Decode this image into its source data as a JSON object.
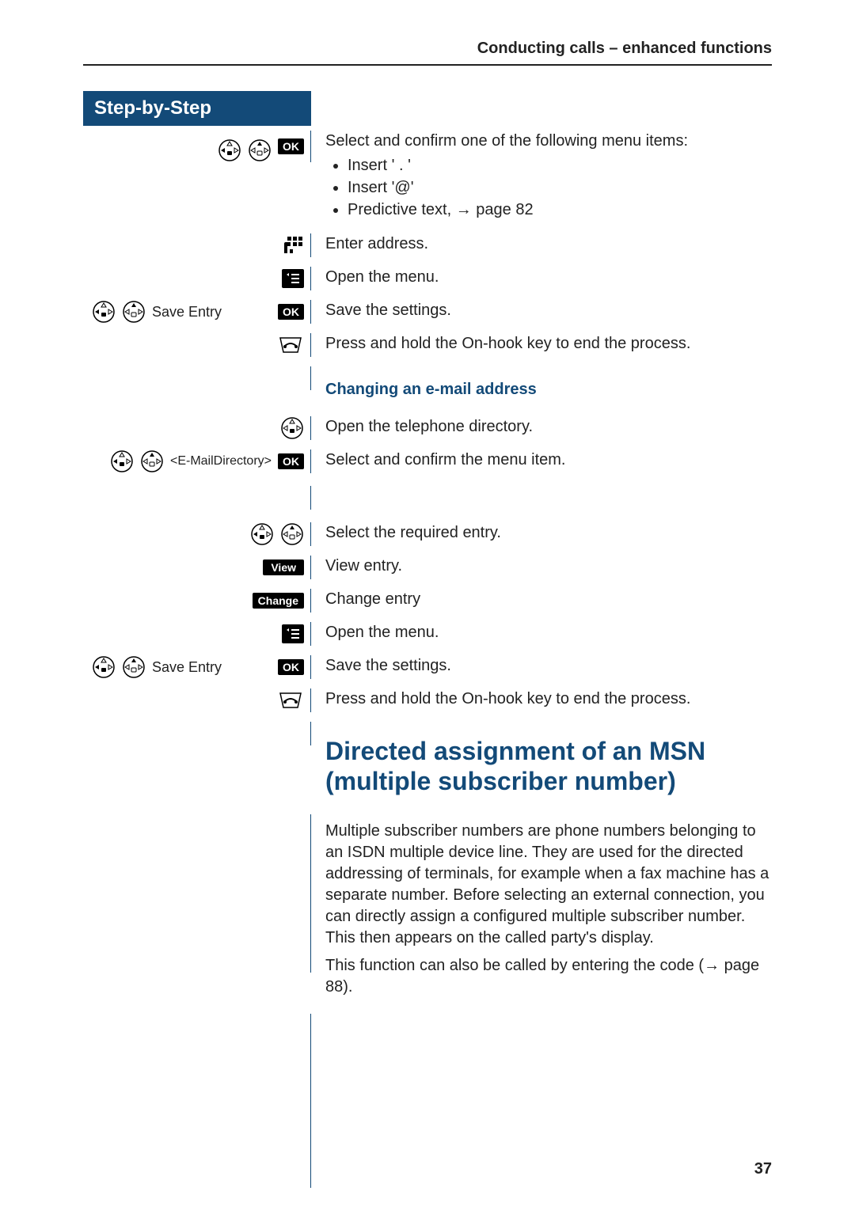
{
  "header": "Conducting calls – enhanced functions",
  "left_header": "Step-by-Step",
  "page_number": "37",
  "block1": {
    "intro": "Select and confirm one of the following menu items:",
    "items": [
      "Insert ' . '",
      "Insert '@'",
      "Predictive text, → page 82"
    ],
    "r2": "Enter address.",
    "r3": "Open the menu.",
    "r4_label": "Save Entry",
    "r4": "Save the settings.",
    "r5": "Press and hold the On-hook key to end the process."
  },
  "subheading": "Changing an e-mail address",
  "block2": {
    "r1": "Open the telephone directory.",
    "r2_label": "<E-MailDirectory>",
    "r2": "Select and confirm the menu item.",
    "r3": "Select the required entry.",
    "r4_btn": "View",
    "r4": "View entry.",
    "r5_btn": "Change",
    "r5": "Change entry",
    "r6": "Open the menu.",
    "r7_label": "Save Entry",
    "r7": "Save the settings.",
    "r8": "Press and hold the On-hook key to end the process."
  },
  "section_title": "Directed assignment of an MSN (multiple subscriber number)",
  "para1": "Multiple subscriber numbers are phone numbers belonging to an ISDN multiple device line. They are used for the directed addressing of terminals, for example when a fax machine has a separate number. Before selecting an external connection, you can directly assign a configured multiple subscriber number. This then appears on the called party's display.",
  "para2": "This function can also be called by entering the code (→ page 88).",
  "labels": {
    "ok": "OK"
  }
}
